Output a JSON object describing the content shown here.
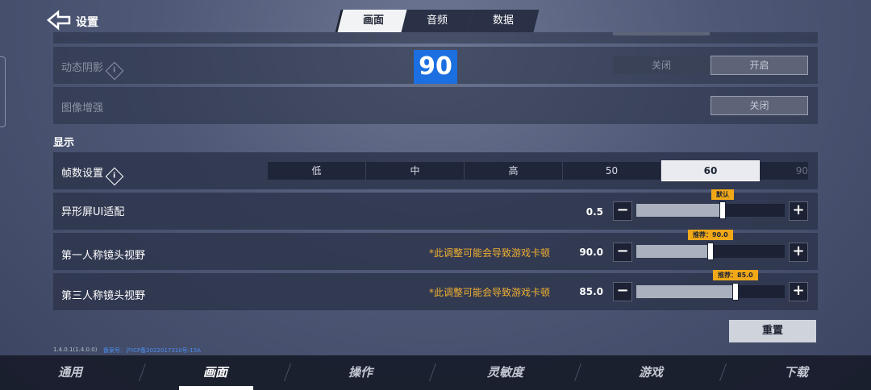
{
  "header": {
    "title": "设置"
  },
  "tabs": [
    {
      "label": "画面",
      "active": true
    },
    {
      "label": "音频",
      "active": false
    },
    {
      "label": "数据",
      "active": false
    }
  ],
  "settings": {
    "dynamic_shadow": {
      "label": "动态阴影",
      "off": "关闭",
      "on": "开启"
    },
    "image_enhance": {
      "label": "图像增强",
      "off": "关闭"
    },
    "overlay_value": "90"
  },
  "display": {
    "section_title": "显示",
    "fps": {
      "label": "帧数设置",
      "options": [
        "低",
        "中",
        "高",
        "50",
        "60",
        "90"
      ],
      "selected": "60"
    },
    "notch_ui": {
      "label": "异形屏UI适配",
      "value": "0.5",
      "tip": "默认",
      "fraction": 0.58
    },
    "fpv_fov": {
      "label": "第一人称镜头视野",
      "warning": "*此调整可能会导致游戏卡顿",
      "value": "90.0",
      "tip": "推荐：90.0",
      "fraction": 0.5
    },
    "tpv_fov": {
      "label": "第三人称镜头视野",
      "warning": "*此调整可能会导致游戏卡顿",
      "value": "85.0",
      "tip": "推荐：85.0",
      "fraction": 0.67
    }
  },
  "reset_label": "重置",
  "version": "1.4.0.1(1.4.0.0)",
  "icp": "备案号：沪ICP备2022017310号-15A",
  "bottom_nav": [
    {
      "label": "通用"
    },
    {
      "label": "画面",
      "active": true
    },
    {
      "label": "操作"
    },
    {
      "label": "灵敏度"
    },
    {
      "label": "游戏"
    },
    {
      "label": "下载"
    }
  ],
  "colors": {
    "accent": "#f0a818",
    "overlay": "#1c6fe0"
  }
}
